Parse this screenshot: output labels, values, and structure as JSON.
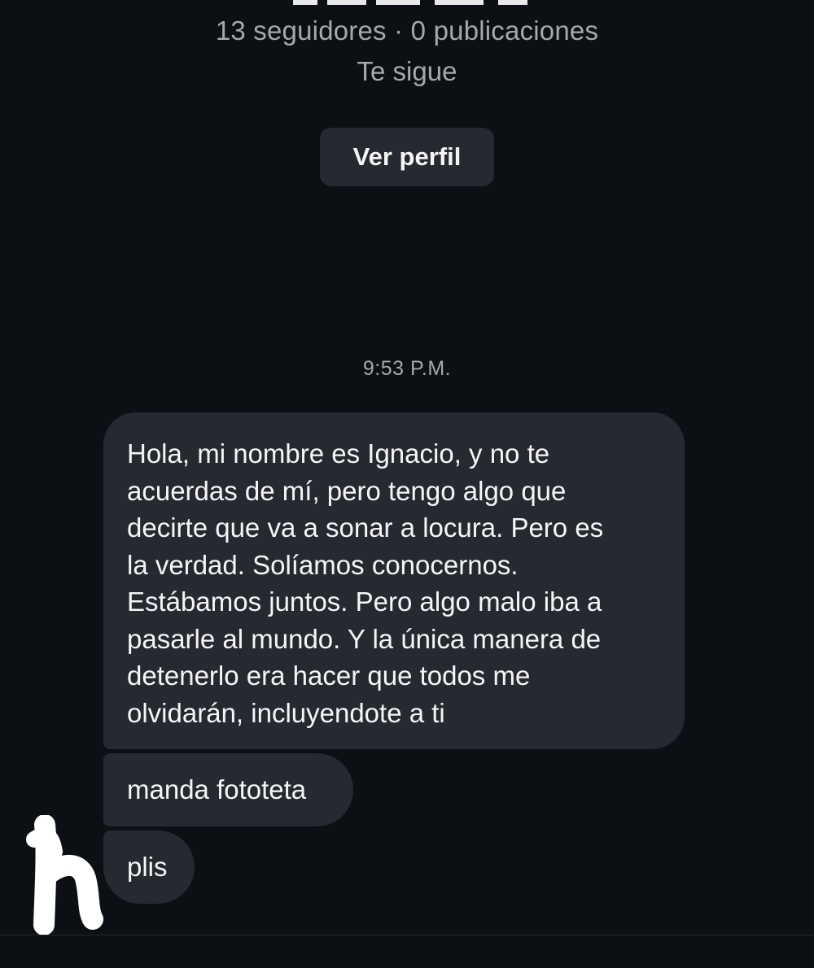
{
  "profile": {
    "stats": "13 seguidores · 0 publicaciones",
    "follow_status": "Te sigue",
    "view_profile_label": "Ver perfil"
  },
  "chat": {
    "timestamp": "9:53 P.M.",
    "messages": [
      {
        "text": "Hola, mi nombre es Ignacio, y no te\nacuerdas de mí, pero tengo algo que\ndecirte que va a sonar a locura. Pero es\nla verdad. Solíamos conocernos.\nEstábamos juntos. Pero algo malo iba a\npasarle al mundo. Y la única manera de\ndetenerlo era hacer que todos me\nolvidarán, incluyendote a ti"
      },
      {
        "text": "manda fototeta"
      },
      {
        "text": "plis"
      }
    ]
  },
  "colors": {
    "background": "#0c1014",
    "bubble": "#262a30",
    "secondary_text": "#a8a8a8",
    "primary_text": "#f5f5f5"
  }
}
